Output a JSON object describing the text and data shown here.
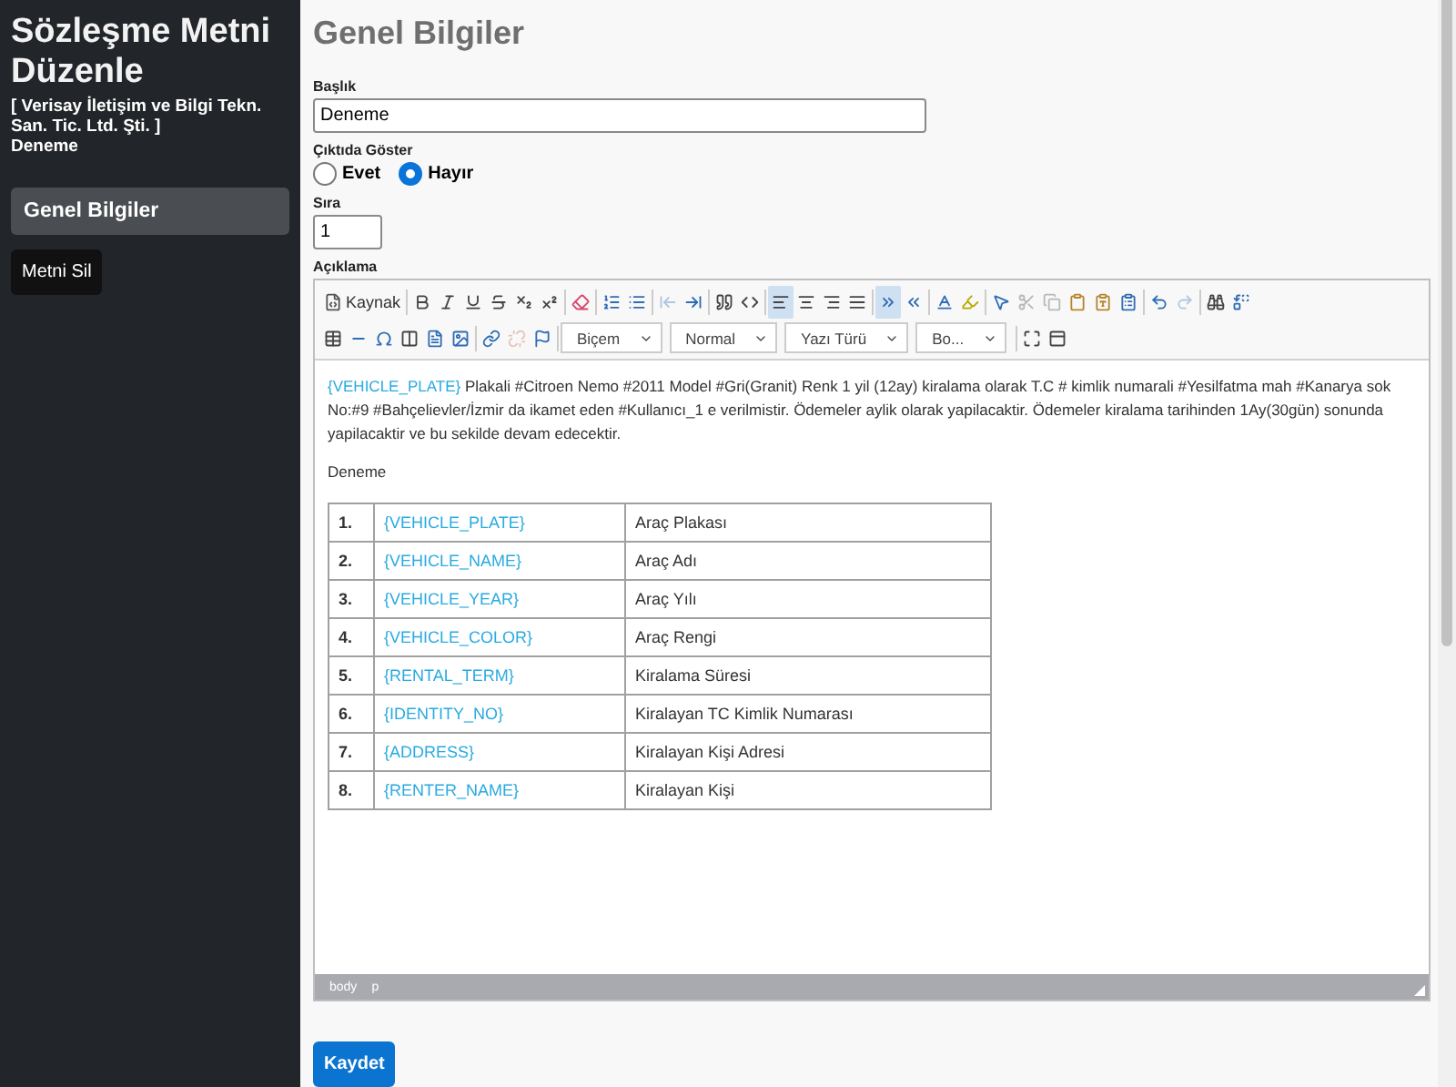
{
  "sidebar": {
    "title": "Sözleşme Metni Düzenle",
    "company": "[ Verisay İletişim ve Bilgi Tekn. San. Tic. Ltd. Şti. ]",
    "subtitle": "Deneme",
    "items": [
      {
        "label": "Genel Bilgiler",
        "selected": true
      }
    ],
    "delete_button": "Metni Sil"
  },
  "main": {
    "heading": "Genel Bilgiler",
    "title_field": {
      "label": "Başlık",
      "value": "Deneme"
    },
    "show_in_output": {
      "label": "Çıktıda Göster",
      "options": [
        {
          "label": "Evet",
          "selected": false
        },
        {
          "label": "Hayır",
          "selected": true
        }
      ]
    },
    "order_field": {
      "label": "Sıra",
      "value": "1"
    },
    "description": {
      "label": "Açıklama",
      "toolbar": [
        [
          {
            "kind": "source",
            "label": "Kaynak",
            "selected": false,
            "disabled": false
          },
          {
            "kind": "sep"
          },
          {
            "kind": "bold",
            "selected": false,
            "disabled": false
          },
          {
            "kind": "italic",
            "selected": false,
            "disabled": false
          },
          {
            "kind": "underline",
            "selected": false,
            "disabled": false
          },
          {
            "kind": "strike",
            "selected": false,
            "disabled": false
          },
          {
            "kind": "subscript",
            "selected": false,
            "disabled": false
          },
          {
            "kind": "superscript",
            "selected": false,
            "disabled": false
          },
          {
            "kind": "sep"
          },
          {
            "kind": "removeformat",
            "selected": false,
            "disabled": false
          },
          {
            "kind": "sep"
          },
          {
            "kind": "numlist",
            "selected": false,
            "disabled": false
          },
          {
            "kind": "bullist",
            "selected": false,
            "disabled": false
          },
          {
            "kind": "sep"
          },
          {
            "kind": "outdent",
            "selected": false,
            "disabled": true
          },
          {
            "kind": "indent",
            "selected": false,
            "disabled": false
          },
          {
            "kind": "sep"
          },
          {
            "kind": "quote",
            "selected": false,
            "disabled": false
          },
          {
            "kind": "div",
            "selected": false,
            "disabled": false
          },
          {
            "kind": "sep"
          },
          {
            "kind": "alignleft",
            "selected": true,
            "disabled": false
          },
          {
            "kind": "aligncenter",
            "selected": false,
            "disabled": false
          },
          {
            "kind": "alignright",
            "selected": false,
            "disabled": false
          },
          {
            "kind": "justify",
            "selected": false,
            "disabled": false
          },
          {
            "kind": "sep"
          },
          {
            "kind": "ltr",
            "selected": true,
            "disabled": false
          },
          {
            "kind": "rtl",
            "selected": false,
            "disabled": false
          },
          {
            "kind": "sep"
          },
          {
            "kind": "textcolor",
            "selected": false,
            "disabled": false
          },
          {
            "kind": "bgcolor",
            "selected": false,
            "disabled": false
          },
          {
            "kind": "sep"
          },
          {
            "kind": "selectall",
            "selected": false,
            "disabled": false
          },
          {
            "kind": "cut",
            "selected": false,
            "disabled": true
          },
          {
            "kind": "copy",
            "selected": false,
            "disabled": true
          },
          {
            "kind": "paste",
            "selected": false,
            "disabled": false
          },
          {
            "kind": "pastetext",
            "selected": false,
            "disabled": false
          },
          {
            "kind": "pasteword",
            "selected": false,
            "disabled": false
          },
          {
            "kind": "sep"
          },
          {
            "kind": "undo",
            "selected": false,
            "disabled": false
          },
          {
            "kind": "redo",
            "selected": false,
            "disabled": true
          },
          {
            "kind": "sep"
          },
          {
            "kind": "find",
            "selected": false,
            "disabled": false
          },
          {
            "kind": "replace",
            "selected": false,
            "disabled": false
          }
        ],
        [
          {
            "kind": "table",
            "selected": false,
            "disabled": false
          },
          {
            "kind": "hr",
            "selected": false,
            "disabled": false
          },
          {
            "kind": "specialchar",
            "selected": false,
            "disabled": false
          },
          {
            "kind": "pagebreak",
            "selected": false,
            "disabled": false
          },
          {
            "kind": "template",
            "selected": false,
            "disabled": false
          },
          {
            "kind": "image",
            "selected": false,
            "disabled": false
          },
          {
            "kind": "sep"
          },
          {
            "kind": "link",
            "selected": false,
            "disabled": false
          },
          {
            "kind": "unlink",
            "selected": false,
            "disabled": true
          },
          {
            "kind": "anchor",
            "selected": false,
            "disabled": false
          },
          {
            "kind": "sep"
          },
          {
            "kind": "combo",
            "label": "Biçem"
          },
          {
            "kind": "combo",
            "label": "Normal"
          },
          {
            "kind": "combo",
            "label": "Yazı Türü"
          },
          {
            "kind": "combo",
            "label": "Bo..."
          },
          {
            "kind": "sep"
          },
          {
            "kind": "maximize",
            "selected": false,
            "disabled": false
          },
          {
            "kind": "showblocks",
            "selected": false,
            "disabled": false
          }
        ]
      ],
      "paragraph": [
        {
          "kind": "placeholder",
          "text": "{VEHICLE_PLATE}"
        },
        {
          "kind": "plain",
          "text": "  Plakali #Citroen Nemo #2011 Model #Gri(Granit)  Renk 1 yil (12ay) kiralama olarak T.C # kimlik numarali  #Yesilfatma mah #Kanarya sok No:#9 #Bahçelievler/İzmir  da ikamet eden #Kullanıcı_1 e verilmistir. Ödemeler aylik olarak yapilacaktir. Ödemeler kiralama tarihinden 1Ay(30gün) sonunda yapilacaktir ve bu sekilde devam edecektir."
        }
      ],
      "note": "Deneme",
      "rows": [
        {
          "number": "1.",
          "placeholder": "{VEHICLE_PLATE}",
          "meaning": "Araç Plakası"
        },
        {
          "number": "2.",
          "placeholder": "{VEHICLE_NAME}",
          "meaning": "Araç Adı"
        },
        {
          "number": "3.",
          "placeholder": "{VEHICLE_YEAR}",
          "meaning": "Araç Yılı"
        },
        {
          "number": "4.",
          "placeholder": "{VEHICLE_COLOR}",
          "meaning": "Araç Rengi"
        },
        {
          "number": "5.",
          "placeholder": "{RENTAL_TERM}",
          "meaning": "Kiralama Süresi"
        },
        {
          "number": "6.",
          "placeholder": "{IDENTITY_NO}",
          "meaning": "Kiralayan TC Kimlik Numarası"
        },
        {
          "number": "7.",
          "placeholder": "{ADDRESS}",
          "meaning": "Kiralayan Kişi Adresi"
        },
        {
          "number": "8.",
          "placeholder": "{RENTER_NAME}",
          "meaning": "Kiralayan Kişi"
        }
      ],
      "path": [
        "body",
        "p"
      ]
    },
    "save_button": "Kaydet"
  }
}
